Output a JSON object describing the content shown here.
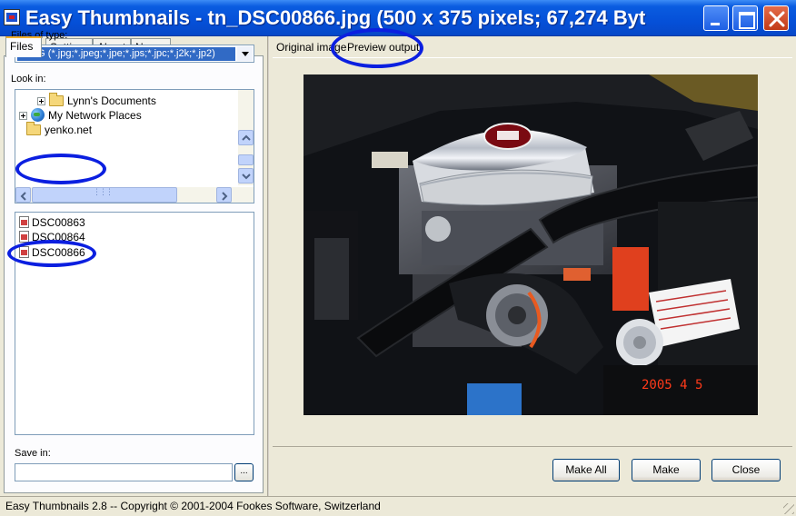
{
  "window": {
    "title": "Easy Thumbnails - tn_DSC00866.jpg  (500 x 375 pixels;  67,274 Byt",
    "controls": [
      "minimize-icon",
      "maximize-icon",
      "close-icon"
    ]
  },
  "left_tabs": [
    "Files",
    "Settings",
    "About",
    "News"
  ],
  "files_tab": {
    "files_of_type_label": "Files of type:",
    "files_of_type_value": "JPEG (*.jpg;*.jpeg;*.jpe;*.jps;*.jpc;*.j2k;*.jp2)",
    "look_in_label": "Look in:",
    "tree": [
      "Lynn's Documents",
      "My Network Places",
      "yenko.net"
    ],
    "files": [
      "DSC00863",
      "DSC00864",
      "DSC00866"
    ],
    "save_in_label": "Save in:",
    "save_in_value": "",
    "browse_label": "..."
  },
  "right_tabs": [
    "Original image",
    "Preview output"
  ],
  "preview": {
    "date_stamp": "2005  4  5"
  },
  "buttons": {
    "make_all": "Make All",
    "make": "Make",
    "close": "Close"
  },
  "status": "Easy Thumbnails 2.8 -- Copyright © 2001-2004 Fookes Software, Switzerland",
  "colors": {
    "title_bar": "#0550d8",
    "selection": "#316ac5",
    "annotation": "#0b1fe0",
    "date_stamp": "#ff3a1a"
  }
}
